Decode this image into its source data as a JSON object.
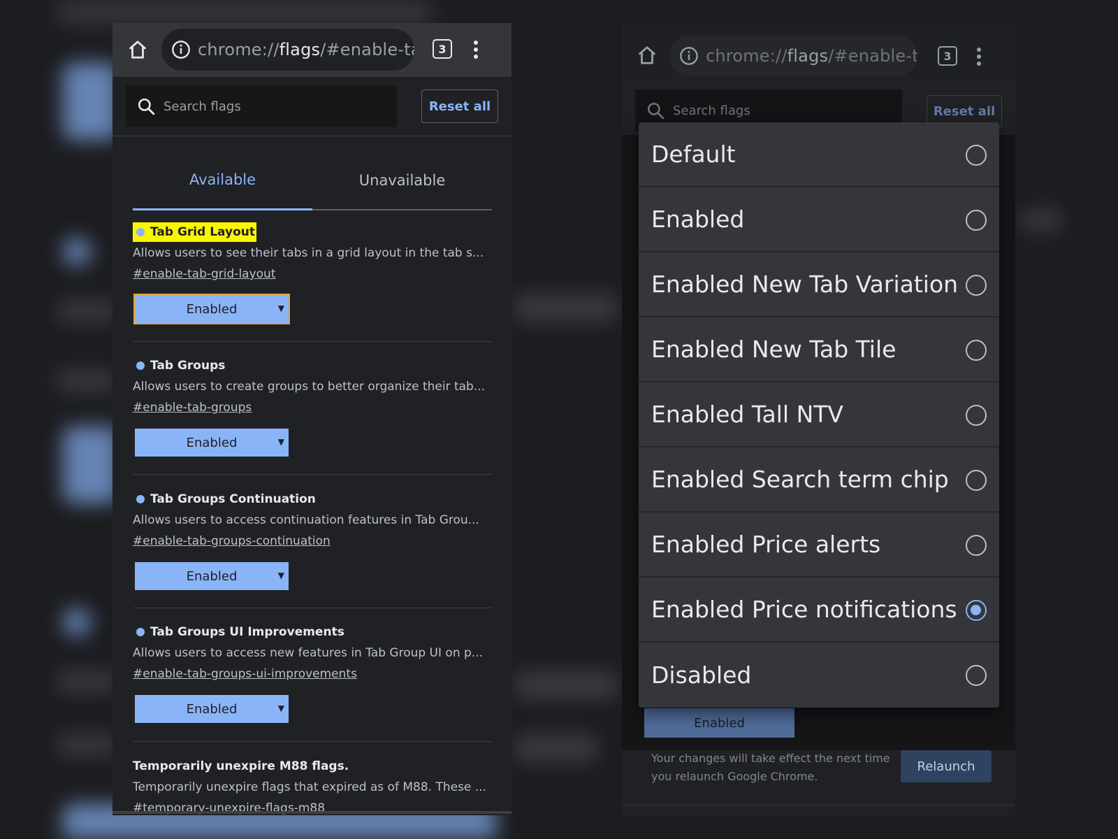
{
  "toolbar": {
    "url_scheme": "chrome://",
    "url_host": "flags",
    "url_path": "/#enable-ta",
    "tab_count": "3",
    "home_icon": "home-icon",
    "info_icon": "info-icon",
    "menu_icon": "more-vert-icon"
  },
  "search": {
    "placeholder": "Search flags",
    "value": "",
    "icon": "search-icon"
  },
  "reset_all_label": "Reset all",
  "tabs": [
    {
      "label": "Available",
      "selected": true
    },
    {
      "label": "Unavailable",
      "selected": false
    }
  ],
  "flags": [
    {
      "title": "Tab Grid Layout",
      "description": "Allows users to see their tabs in a grid layout in the tab s...",
      "link": "#enable-tab-grid-layout",
      "value": "Enabled",
      "highlighted": true
    },
    {
      "title": "Tab Groups",
      "description": "Allows users to create groups to better organize their tab...",
      "link": "#enable-tab-groups",
      "value": "Enabled",
      "highlighted": false
    },
    {
      "title": "Tab Groups Continuation",
      "description": "Allows users to access continuation features in Tab Grou...",
      "link": "#enable-tab-groups-continuation",
      "value": "Enabled",
      "highlighted": false
    },
    {
      "title": "Tab Groups UI Improvements",
      "description": "Allows users to access new features in Tab Group UI on p...",
      "link": "#enable-tab-groups-ui-improvements",
      "value": "Enabled",
      "highlighted": false
    },
    {
      "title": "Temporarily unexpire M88 flags.",
      "description": "Temporarily unexpire flags that expired as of M88. These ...",
      "link": "#temporary-unexpire-flags-m88"
    }
  ],
  "dialog": {
    "options": [
      {
        "label": "Default",
        "checked": false
      },
      {
        "label": "Enabled",
        "checked": false
      },
      {
        "label": "Enabled New Tab Variation",
        "checked": false
      },
      {
        "label": "Enabled New Tab Tile",
        "checked": false
      },
      {
        "label": "Enabled Tall NTV",
        "checked": false
      },
      {
        "label": "Enabled Search term chip",
        "checked": false
      },
      {
        "label": "Enabled Price alerts",
        "checked": false
      },
      {
        "label": "Enabled Price notifications",
        "checked": true
      },
      {
        "label": "Disabled",
        "checked": false
      }
    ]
  },
  "behind_dialog_select": "Enabled",
  "relaunch": {
    "message": "Your changes will take effect the next time you relaunch Google Chrome.",
    "button_label": "Relaunch"
  },
  "colors": {
    "accent": "#8ab4f8",
    "highlight": "#f9f700",
    "surface": "#202124",
    "toolbar": "#35363a"
  }
}
